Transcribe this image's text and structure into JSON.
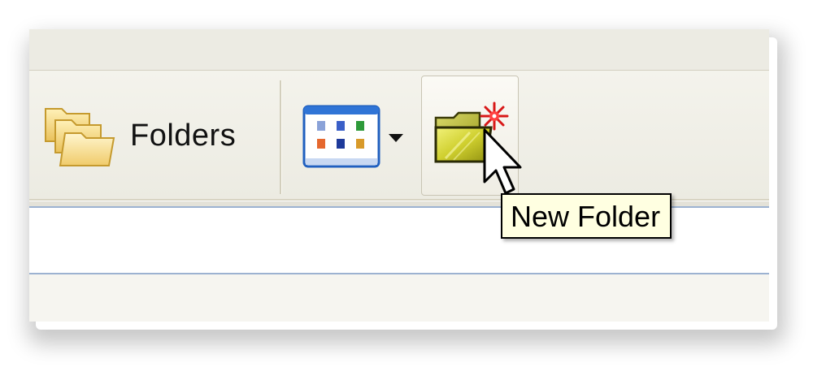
{
  "toolbar": {
    "folders_label": "Folders",
    "views_icon": "views-grid-icon",
    "new_folder_icon": "new-folder-icon"
  },
  "tooltip": {
    "text": "New Folder"
  },
  "colors": {
    "toolbar_bg": "#ecebe2",
    "tooltip_bg": "#ffffe1",
    "frame_blue": "#9cb2d1"
  }
}
